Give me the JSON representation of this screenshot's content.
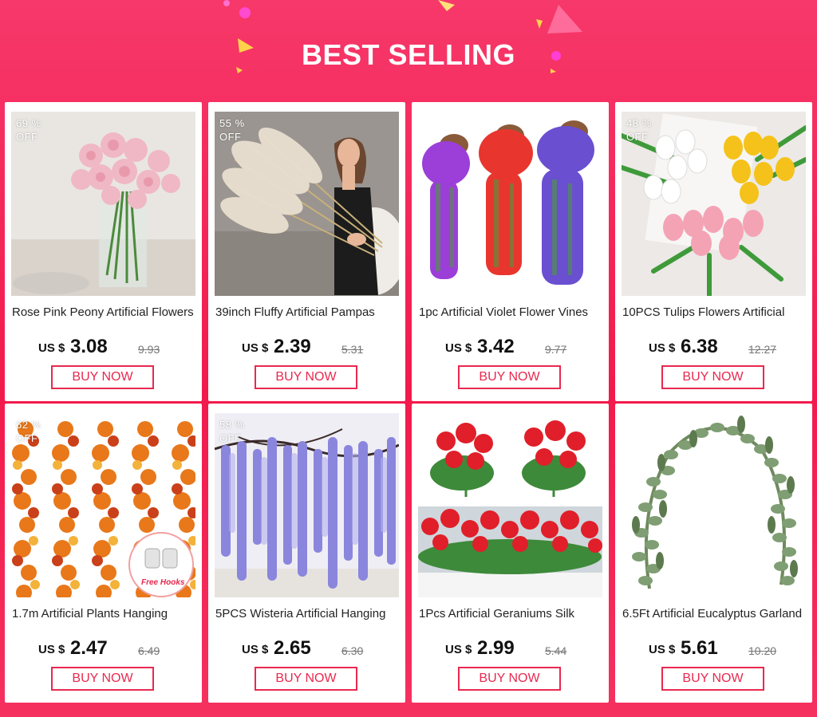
{
  "banner": {
    "title": "BEST SELLING"
  },
  "colors": {
    "background": "#f21a4c",
    "accent": "#e8294f"
  },
  "products": [
    {
      "title": "Rose Pink Peony Artificial Flowers",
      "discount_pct": "69 %",
      "discount_off": "OFF",
      "currency": "US $",
      "price": "3.08",
      "old_price": "9.93",
      "button": "BUY NOW",
      "image": "pink-peony-vase-image"
    },
    {
      "title": "39inch Fluffy Artificial Pampas",
      "discount_pct": "55 %",
      "discount_off": "OFF",
      "currency": "US $",
      "price": "2.39",
      "old_price": "5.31",
      "button": "BUY NOW",
      "image": "pampas-grass-model-image"
    },
    {
      "title": "1pc Artificial Violet Flower Vines",
      "discount_pct": "",
      "discount_off": "",
      "currency": "US $",
      "price": "3.42",
      "old_price": "9.77",
      "button": "BUY NOW",
      "image": "violet-flower-vines-image"
    },
    {
      "title": "10PCS Tulips Flowers Artificial",
      "discount_pct": "48 %",
      "discount_off": "OFF",
      "currency": "US $",
      "price": "6.38",
      "old_price": "12.27",
      "button": "BUY NOW",
      "image": "tulips-image"
    },
    {
      "title": "1.7m Artificial Plants Hanging",
      "discount_pct": "62 %",
      "discount_off": "OFF",
      "currency": "US $",
      "price": "2.47",
      "old_price": "6.49",
      "button": "BUY NOW",
      "image": "maple-leaf-garland-image",
      "badge": "Free Hooks"
    },
    {
      "title": "5PCS Wisteria Artificial Hanging",
      "discount_pct": "58 %",
      "discount_off": "OFF",
      "currency": "US $",
      "price": "2.65",
      "old_price": "6.30",
      "button": "BUY NOW",
      "image": "wisteria-image"
    },
    {
      "title": "1Pcs Artificial Geraniums Silk",
      "discount_pct": "",
      "discount_off": "",
      "currency": "US $",
      "price": "2.99",
      "old_price": "5.44",
      "button": "BUY NOW",
      "image": "red-geraniums-image"
    },
    {
      "title": "6.5Ft Artificial Eucalyptus Garland",
      "discount_pct": "",
      "discount_off": "",
      "currency": "US $",
      "price": "5.61",
      "old_price": "10.20",
      "button": "BUY NOW",
      "image": "eucalyptus-garland-image"
    }
  ]
}
